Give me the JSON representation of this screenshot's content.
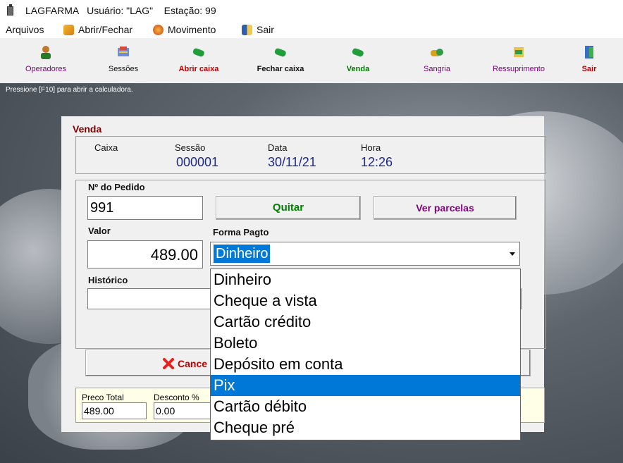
{
  "window": {
    "title": "LAGFARMA   Usuário: \"LAG\"    Estação: 99"
  },
  "menu": {
    "items": [
      {
        "label": "Arquivos",
        "icon": ""
      },
      {
        "label": "Abrir/Fechar",
        "icon": "open-close-icon"
      },
      {
        "label": "Movimento",
        "icon": "movement-icon"
      },
      {
        "label": "Sair",
        "icon": "exit-icon"
      }
    ]
  },
  "toolbar": {
    "buttons": [
      {
        "label": "Operadores",
        "color": "#800080",
        "icon": "operators-icon"
      },
      {
        "label": "Sessões",
        "color": "#111111",
        "icon": "sessions-icon"
      },
      {
        "label": "Abrir caixa",
        "color": "#c00000",
        "icon": "cash-icon"
      },
      {
        "label": "Fechar caixa",
        "color": "#111111",
        "icon": "cash-icon"
      },
      {
        "label": "Venda",
        "color": "#007a00",
        "icon": "cash-icon"
      },
      {
        "label": "Sangria",
        "color": "#800080",
        "icon": "withdrawal-icon"
      },
      {
        "label": "Ressuprimento",
        "color": "#800080",
        "icon": "resupply-icon"
      },
      {
        "label": "Sair",
        "color": "#c00000",
        "icon": "door-exit-icon"
      }
    ]
  },
  "status": {
    "hint": "Pressione [F10]  para abrir a calculadora."
  },
  "dialog": {
    "title": "Venda",
    "info": {
      "caixa_label": "Caixa",
      "sessao_label": "Sessão",
      "sessao_value": "000001",
      "data_label": "Data",
      "data_value": "30/11/21",
      "hora_label": "Hora",
      "hora_value": "12:26"
    },
    "pedido_label": "Nº do Pedido",
    "pedido_value": "991",
    "quitar_label": "Quitar",
    "ver_parcelas_label": "Ver parcelas",
    "valor_label": "Valor",
    "valor_value": "489.00",
    "forma_pagto_label": "Forma Pagto",
    "forma_pagto_selected": "Dinheiro",
    "historico_label": "Histórico",
    "historico_value": "",
    "cancel_label": "Cance",
    "totals": {
      "preco_total_label": "Preco Total",
      "preco_total_value": "489.00",
      "desconto_label": "Desconto %",
      "desconto_value": "0.00"
    }
  },
  "dropdown": {
    "options": [
      "Dinheiro",
      "Cheque a vista",
      "Cartão crédito",
      "Boleto",
      "Depósito em conta",
      "Pix",
      "Cartão débito",
      "Cheque pré"
    ],
    "highlighted": "Pix"
  },
  "colors": {
    "title_red": "#800000",
    "value_blue": "#1f2a8a",
    "quitar_green": "#008000",
    "ver_parcelas_purple": "#800080",
    "highlight_blue": "#0078d7"
  }
}
